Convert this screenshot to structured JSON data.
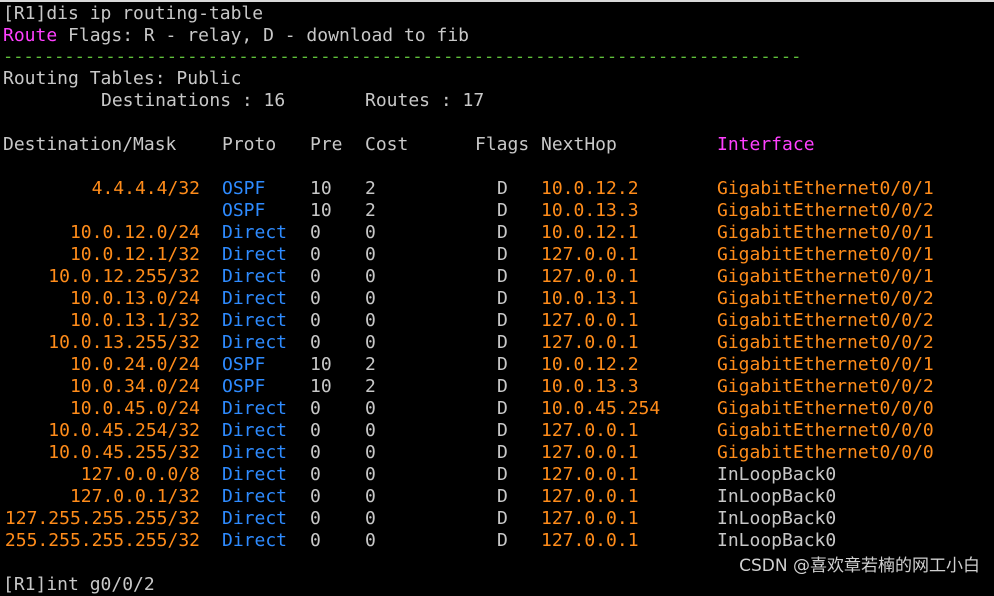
{
  "terminal": {
    "command_line": "[R1]dis ip routing-table",
    "flags_word": "Route",
    "flags_rest": " Flags: R - relay, D - download to fib",
    "separator": "------------------------------------------------------------------------------",
    "tables_title": "Routing Tables: Public",
    "destinations_label": "Destinations : 16",
    "routes_label": "Routes : 17",
    "headers": {
      "destination": "Destination/Mask",
      "proto": "Proto",
      "pre": "Pre",
      "cost": "Cost",
      "flags": "Flags",
      "nexthop": "NextHop",
      "interface": "Interface"
    },
    "routes": [
      {
        "dest": "4.4.4.4/32",
        "proto": "OSPF",
        "pre": "10",
        "cost": "2",
        "flags": "D",
        "nexthop": "10.0.12.2",
        "iface": "GigabitEthernet0/0/1"
      },
      {
        "dest": "",
        "proto": "OSPF",
        "pre": "10",
        "cost": "2",
        "flags": "D",
        "nexthop": "10.0.13.3",
        "iface": "GigabitEthernet0/0/2"
      },
      {
        "dest": "10.0.12.0/24",
        "proto": "Direct",
        "pre": "0",
        "cost": "0",
        "flags": "D",
        "nexthop": "10.0.12.1",
        "iface": "GigabitEthernet0/0/1"
      },
      {
        "dest": "10.0.12.1/32",
        "proto": "Direct",
        "pre": "0",
        "cost": "0",
        "flags": "D",
        "nexthop": "127.0.0.1",
        "iface": "GigabitEthernet0/0/1"
      },
      {
        "dest": "10.0.12.255/32",
        "proto": "Direct",
        "pre": "0",
        "cost": "0",
        "flags": "D",
        "nexthop": "127.0.0.1",
        "iface": "GigabitEthernet0/0/1"
      },
      {
        "dest": "10.0.13.0/24",
        "proto": "Direct",
        "pre": "0",
        "cost": "0",
        "flags": "D",
        "nexthop": "10.0.13.1",
        "iface": "GigabitEthernet0/0/2"
      },
      {
        "dest": "10.0.13.1/32",
        "proto": "Direct",
        "pre": "0",
        "cost": "0",
        "flags": "D",
        "nexthop": "127.0.0.1",
        "iface": "GigabitEthernet0/0/2"
      },
      {
        "dest": "10.0.13.255/32",
        "proto": "Direct",
        "pre": "0",
        "cost": "0",
        "flags": "D",
        "nexthop": "127.0.0.1",
        "iface": "GigabitEthernet0/0/2"
      },
      {
        "dest": "10.0.24.0/24",
        "proto": "OSPF",
        "pre": "10",
        "cost": "2",
        "flags": "D",
        "nexthop": "10.0.12.2",
        "iface": "GigabitEthernet0/0/1"
      },
      {
        "dest": "10.0.34.0/24",
        "proto": "OSPF",
        "pre": "10",
        "cost": "2",
        "flags": "D",
        "nexthop": "10.0.13.3",
        "iface": "GigabitEthernet0/0/2"
      },
      {
        "dest": "10.0.45.0/24",
        "proto": "Direct",
        "pre": "0",
        "cost": "0",
        "flags": "D",
        "nexthop": "10.0.45.254",
        "iface": "GigabitEthernet0/0/0"
      },
      {
        "dest": "10.0.45.254/32",
        "proto": "Direct",
        "pre": "0",
        "cost": "0",
        "flags": "D",
        "nexthop": "127.0.0.1",
        "iface": "GigabitEthernet0/0/0"
      },
      {
        "dest": "10.0.45.255/32",
        "proto": "Direct",
        "pre": "0",
        "cost": "0",
        "flags": "D",
        "nexthop": "127.0.0.1",
        "iface": "GigabitEthernet0/0/0"
      },
      {
        "dest": "127.0.0.0/8",
        "proto": "Direct",
        "pre": "0",
        "cost": "0",
        "flags": "D",
        "nexthop": "127.0.0.1",
        "iface": "InLoopBack0"
      },
      {
        "dest": "127.0.0.1/32",
        "proto": "Direct",
        "pre": "0",
        "cost": "0",
        "flags": "D",
        "nexthop": "127.0.0.1",
        "iface": "InLoopBack0"
      },
      {
        "dest": "127.255.255.255/32",
        "proto": "Direct",
        "pre": "0",
        "cost": "0",
        "flags": "D",
        "nexthop": "127.0.0.1",
        "iface": "InLoopBack0"
      },
      {
        "dest": "255.255.255.255/32",
        "proto": "Direct",
        "pre": "0",
        "cost": "0",
        "flags": "D",
        "nexthop": "127.0.0.1",
        "iface": "InLoopBack0"
      }
    ],
    "next_prompt": "[R1]int g0/0/2"
  },
  "watermark": "CSDN @喜欢章若楠的网工小白",
  "colors": {
    "background": "#000000",
    "text": "#c8c8c8",
    "magenta": "#ff40ff",
    "orange": "#ff8c1a",
    "blue": "#2e8bff",
    "green": "#5fbf3a"
  }
}
